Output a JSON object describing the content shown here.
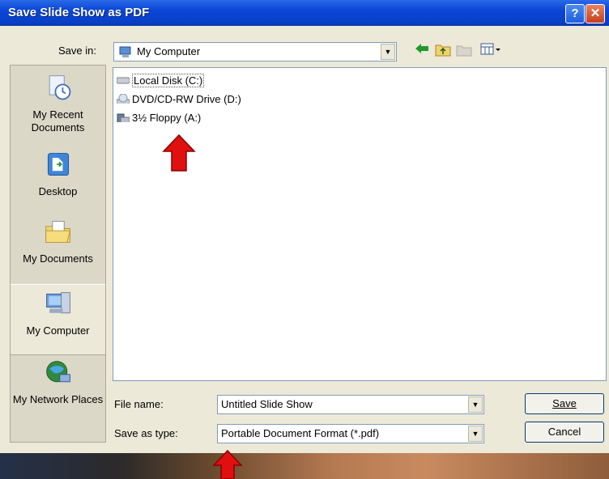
{
  "window": {
    "title": "Save Slide Show as PDF",
    "help_glyph": "?",
    "close_glyph": "✕"
  },
  "save_in": {
    "label": "Save in:",
    "value": "My Computer",
    "arrow": "▼"
  },
  "places": [
    {
      "label": "My Recent Documents"
    },
    {
      "label": "Desktop"
    },
    {
      "label": "My Documents"
    },
    {
      "label": "My Computer"
    },
    {
      "label": "My Network Places"
    }
  ],
  "files": [
    {
      "label": "Local Disk (C:)"
    },
    {
      "label": "DVD/CD-RW Drive (D:)"
    },
    {
      "label": "3½ Floppy (A:)"
    }
  ],
  "form": {
    "file_name_label": "File name:",
    "file_name_value": "Untitled Slide Show",
    "save_type_label": "Save as type:",
    "save_type_value": "Portable Document Format (*.pdf)",
    "save_button": "Save",
    "cancel_button": "Cancel",
    "arrow": "▼"
  },
  "colors": {
    "titlebar": "#0a46d6",
    "annotation_arrow": "#e01010"
  }
}
